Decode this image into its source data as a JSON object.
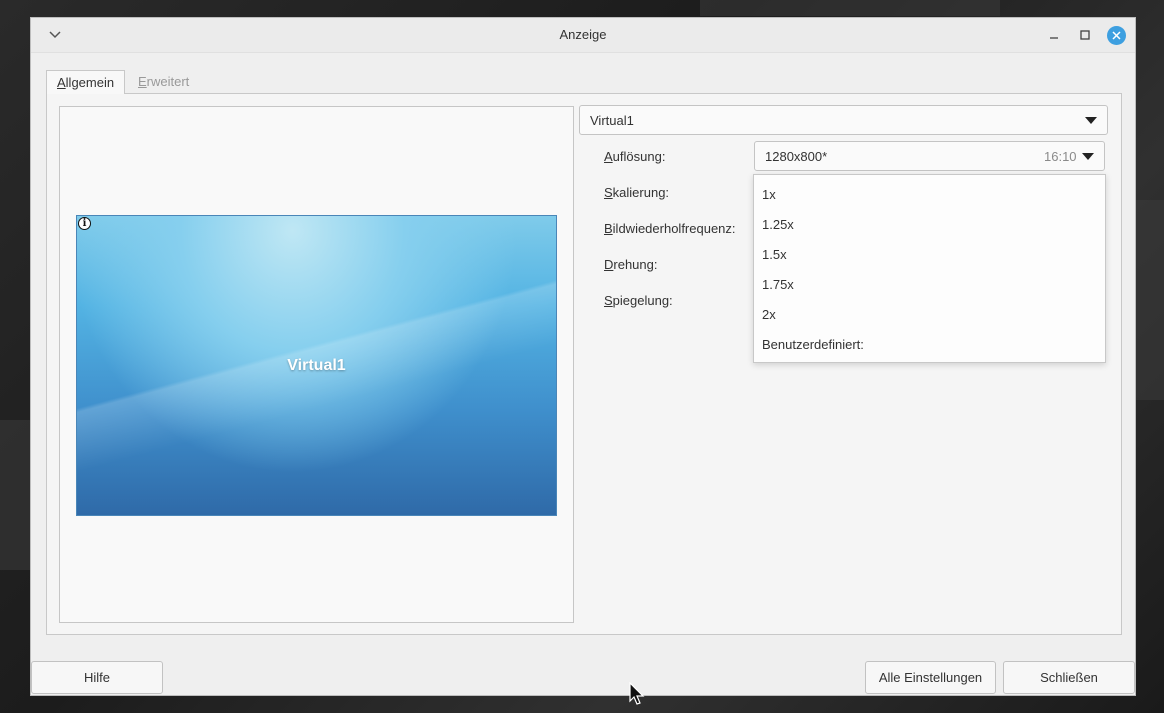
{
  "window": {
    "title": "Anzeige"
  },
  "tabs": [
    {
      "prefix": "",
      "mnemonic": "A",
      "rest": "llgemein",
      "active": true
    },
    {
      "prefix": "",
      "mnemonic": "E",
      "rest": "rweitert",
      "active": false
    }
  ],
  "preview": {
    "monitor_label": "Virtual1",
    "info_icon": "info-icon"
  },
  "output_select": {
    "value": "Virtual1"
  },
  "settings": {
    "resolution": {
      "mnemonic": "A",
      "rest": "uflösung:",
      "value": "1280x800*",
      "aspect": "16:10"
    },
    "scaling": {
      "mnemonic": "S",
      "rest": "kalierung:"
    },
    "refresh": {
      "mnemonic": "B",
      "rest": "ildwiederholfrequenz:"
    },
    "rotation": {
      "mnemonic": "D",
      "rest": "rehung:"
    },
    "reflection": {
      "mnemonic": "S",
      "rest": "piegelung:"
    }
  },
  "scaling_popup": {
    "options": [
      "1x",
      "1.25x",
      "1.5x",
      "1.75x",
      "2x",
      "Benutzerdefiniert:"
    ]
  },
  "buttons": {
    "help": "Hilfe",
    "all_settings": "Alle Einstellungen",
    "close": "Schließen"
  },
  "colors": {
    "close_button": "#3d9fe0",
    "monitor_top": "#7fcbea",
    "monitor_bottom": "#2f6aa8"
  }
}
